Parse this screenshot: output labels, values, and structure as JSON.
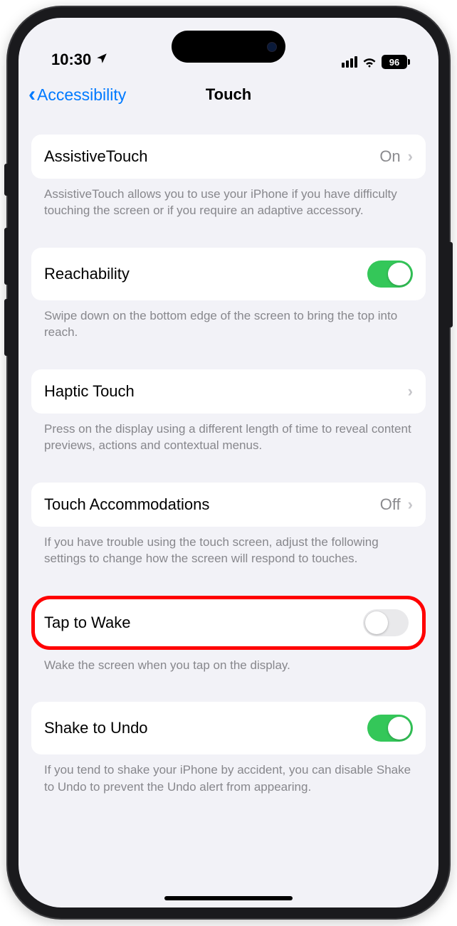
{
  "status": {
    "time": "10:30",
    "battery": "96"
  },
  "nav": {
    "back": "Accessibility",
    "title": "Touch"
  },
  "rows": {
    "assistive": {
      "label": "AssistiveTouch",
      "value": "On",
      "footer": "AssistiveTouch allows you to use your iPhone if you have difficulty touching the screen or if you require an adaptive accessory."
    },
    "reachability": {
      "label": "Reachability",
      "footer": "Swipe down on the bottom edge of the screen to bring the top into reach."
    },
    "haptic": {
      "label": "Haptic Touch",
      "footer": "Press on the display using a different length of time to reveal content previews, actions and contextual menus."
    },
    "accommodations": {
      "label": "Touch Accommodations",
      "value": "Off",
      "footer": "If you have trouble using the touch screen, adjust the following settings to change how the screen will respond to touches."
    },
    "tap_wake": {
      "label": "Tap to Wake",
      "footer": "Wake the screen when you tap on the display."
    },
    "shake": {
      "label": "Shake to Undo",
      "footer": "If you tend to shake your iPhone by accident, you can disable Shake to Undo to prevent the Undo alert from appearing."
    }
  }
}
